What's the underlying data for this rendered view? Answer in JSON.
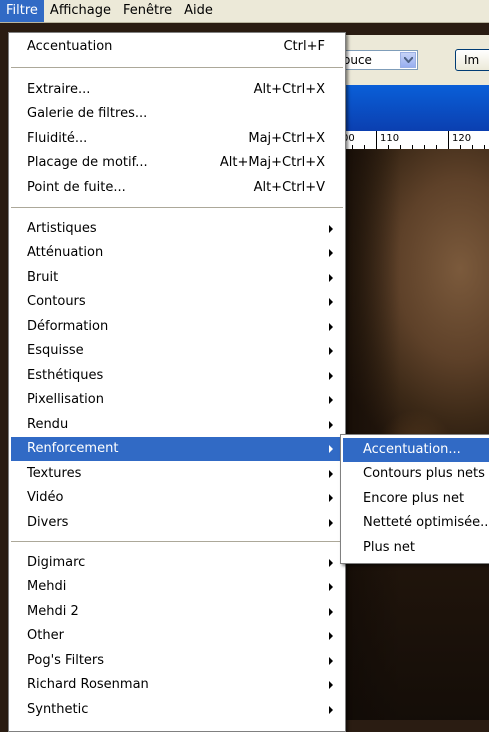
{
  "menubar": {
    "items": [
      {
        "label": "Filtre",
        "active": true
      },
      {
        "label": "Affichage",
        "active": false
      },
      {
        "label": "Fenêtre",
        "active": false
      },
      {
        "label": "Aide",
        "active": false
      }
    ]
  },
  "background": {
    "combo_value": "ouce",
    "button_label": "Im",
    "ruler_labels": [
      "00",
      "110",
      "120"
    ]
  },
  "filter_menu": {
    "items": [
      {
        "label": "Accentuation",
        "shortcut": "Ctrl+F"
      },
      {
        "label": "Extraire...",
        "shortcut": "Alt+Ctrl+X"
      },
      {
        "label": "Galerie de filtres...",
        "shortcut": ""
      },
      {
        "label": "Fluidité...",
        "shortcut": "Maj+Ctrl+X"
      },
      {
        "label": "Placage de motif...",
        "shortcut": "Alt+Maj+Ctrl+X"
      },
      {
        "label": "Point de fuite...",
        "shortcut": "Alt+Ctrl+V"
      },
      {
        "label": "Artistiques",
        "submenu": true
      },
      {
        "label": "Atténuation",
        "submenu": true
      },
      {
        "label": "Bruit",
        "submenu": true
      },
      {
        "label": "Contours",
        "submenu": true
      },
      {
        "label": "Déformation",
        "submenu": true
      },
      {
        "label": "Esquisse",
        "submenu": true
      },
      {
        "label": "Esthétiques",
        "submenu": true
      },
      {
        "label": "Pixellisation",
        "submenu": true
      },
      {
        "label": "Rendu",
        "submenu": true
      },
      {
        "label": "Renforcement",
        "submenu": true,
        "highlighted": true
      },
      {
        "label": "Textures",
        "submenu": true
      },
      {
        "label": "Vidéo",
        "submenu": true
      },
      {
        "label": "Divers",
        "submenu": true
      },
      {
        "label": "Digimarc",
        "submenu": true
      },
      {
        "label": "Mehdi",
        "submenu": true
      },
      {
        "label": "Mehdi 2",
        "submenu": true
      },
      {
        "label": "Other",
        "submenu": true
      },
      {
        "label": "Pog's Filters",
        "submenu": true
      },
      {
        "label": "Richard Rosenman",
        "submenu": true
      },
      {
        "label": "Synthetic",
        "submenu": true
      }
    ]
  },
  "renforcement_submenu": {
    "items": [
      {
        "label": "Accentuation...",
        "highlighted": true
      },
      {
        "label": "Contours plus nets"
      },
      {
        "label": "Encore plus net"
      },
      {
        "label": "Netteté optimisée..."
      },
      {
        "label": "Plus net"
      }
    ]
  },
  "colors": {
    "highlight": "#316ac5",
    "menubar": "#ece9d8"
  }
}
